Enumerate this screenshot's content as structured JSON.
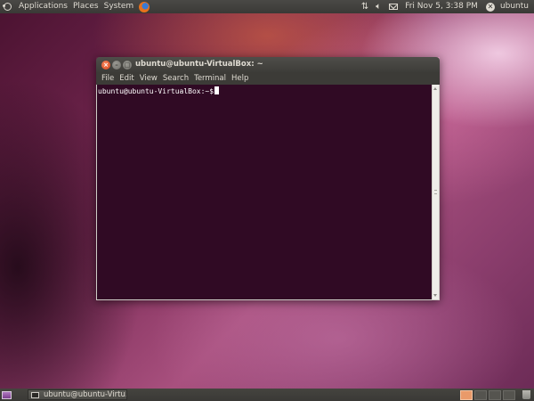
{
  "top_panel": {
    "menus": [
      "Applications",
      "Places",
      "System"
    ],
    "clock": "Fri Nov  5,  3:38 PM",
    "user": "ubuntu"
  },
  "icons": {
    "logo": "ubuntu-logo-icon",
    "browser": "firefox-icon",
    "network": "network-arrows-icon",
    "volume": "volume-icon",
    "mail": "mail-icon",
    "session": "session-power-icon",
    "show_desktop": "show-desktop-icon",
    "terminal": "terminal-icon",
    "trash": "trash-icon"
  },
  "terminal": {
    "title": "ubuntu@ubuntu-VirtualBox: ~",
    "menus": [
      "File",
      "Edit",
      "View",
      "Search",
      "Terminal",
      "Help"
    ],
    "prompt": "ubuntu@ubuntu-VirtualBox:~$",
    "background": "#300a24"
  },
  "bottom_panel": {
    "task_label": "ubuntu@ubuntu-Virtu..."
  }
}
